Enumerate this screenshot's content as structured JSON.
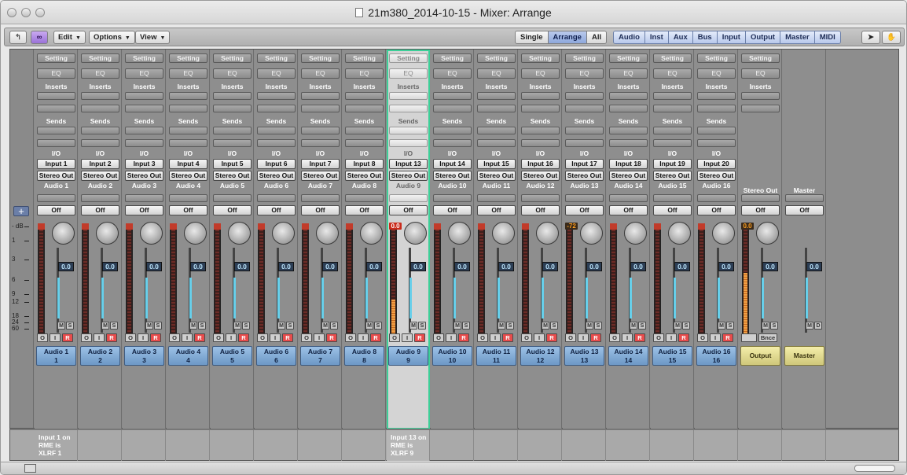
{
  "window": {
    "title": "21m380_2014-10-15 - Mixer: Arrange"
  },
  "toolbar": {
    "edit": "Edit",
    "options": "Options",
    "view": "View",
    "view_modes": [
      "Single",
      "Arrange",
      "All"
    ],
    "active_mode": "Arrange",
    "filters": [
      "Audio",
      "Inst",
      "Aux",
      "Bus",
      "Input",
      "Output",
      "Master",
      "MIDI"
    ]
  },
  "ruler": {
    "unit": "- dB",
    "ticks": [
      "1",
      "3",
      "6",
      "9",
      "12",
      "18",
      "24",
      "60"
    ],
    "add_label": "+"
  },
  "strip_labels": {
    "setting": "Setting",
    "eq": "EQ",
    "inserts": "Inserts",
    "sends": "Sends",
    "io": "I/O",
    "automation": "Off"
  },
  "strips": [
    {
      "input": "Input 1",
      "output": "Stereo Out",
      "track": "Audio 1",
      "name": "Audio 1",
      "num": "1",
      "vol": "0.0",
      "note": "Input 1 on RME is XLRF 1"
    },
    {
      "input": "Input 2",
      "output": "Stereo Out",
      "track": "Audio 2",
      "name": "Audio 2",
      "num": "2",
      "vol": "0.0",
      "note": ""
    },
    {
      "input": "Input 3",
      "output": "Stereo Out",
      "track": "Audio 3",
      "name": "Audio 3",
      "num": "3",
      "vol": "0.0",
      "note": ""
    },
    {
      "input": "Input 4",
      "output": "Stereo Out",
      "track": "Audio 4",
      "name": "Audio 4",
      "num": "4",
      "vol": "0.0",
      "note": ""
    },
    {
      "input": "Input 5",
      "output": "Stereo Out",
      "track": "Audio 5",
      "name": "Audio 5",
      "num": "5",
      "vol": "0.0",
      "note": ""
    },
    {
      "input": "Input 6",
      "output": "Stereo Out",
      "track": "Audio 6",
      "name": "Audio 6",
      "num": "6",
      "vol": "0.0",
      "note": ""
    },
    {
      "input": "Input 7",
      "output": "Stereo Out",
      "track": "Audio 7",
      "name": "Audio 7",
      "num": "7",
      "vol": "0.0",
      "note": ""
    },
    {
      "input": "Input 8",
      "output": "Stereo Out",
      "track": "Audio 8",
      "name": "Audio 8",
      "num": "8",
      "vol": "0.0",
      "note": ""
    },
    {
      "input": "Input 13",
      "output": "Stereo Out",
      "track": "Audio 9",
      "name": "Audio 9",
      "num": "9",
      "vol": "0.0",
      "note": "Input 13 on RME is XLRF 9",
      "peak": "0.0"
    },
    {
      "input": "Input 14",
      "output": "Stereo Out",
      "track": "Audio 10",
      "name": "Audio 10",
      "num": "10",
      "vol": "0.0",
      "note": ""
    },
    {
      "input": "Input 15",
      "output": "Stereo Out",
      "track": "Audio 11",
      "name": "Audio 11",
      "num": "11",
      "vol": "0.0",
      "note": ""
    },
    {
      "input": "Input 16",
      "output": "Stereo Out",
      "track": "Audio 12",
      "name": "Audio 12",
      "num": "12",
      "vol": "0.0",
      "note": ""
    },
    {
      "input": "Input 17",
      "output": "Stereo Out",
      "track": "Audio 13",
      "name": "Audio 13",
      "num": "13",
      "vol": "0.0",
      "note": "",
      "peak": "-72"
    },
    {
      "input": "Input 18",
      "output": "Stereo Out",
      "track": "Audio 14",
      "name": "Audio 14",
      "num": "14",
      "vol": "0.0",
      "note": ""
    },
    {
      "input": "Input 19",
      "output": "Stereo Out",
      "track": "Audio 15",
      "name": "Audio 15",
      "num": "15",
      "vol": "0.0",
      "note": ""
    },
    {
      "input": "Input 20",
      "output": "Stereo Out",
      "track": "Audio 16",
      "name": "Audio 16",
      "num": "16",
      "vol": "0.0",
      "note": ""
    }
  ],
  "output_strip": {
    "track": "Stereo Out",
    "name": "Output",
    "vol": "0.0",
    "peak": "0.0",
    "bnce": "Bnce"
  },
  "master_strip": {
    "track": "Master",
    "name": "Master",
    "vol": "0.0"
  },
  "buttons": {
    "m": "M",
    "s": "S",
    "d": "D",
    "o": "O",
    "i": "I",
    "r": "R"
  }
}
